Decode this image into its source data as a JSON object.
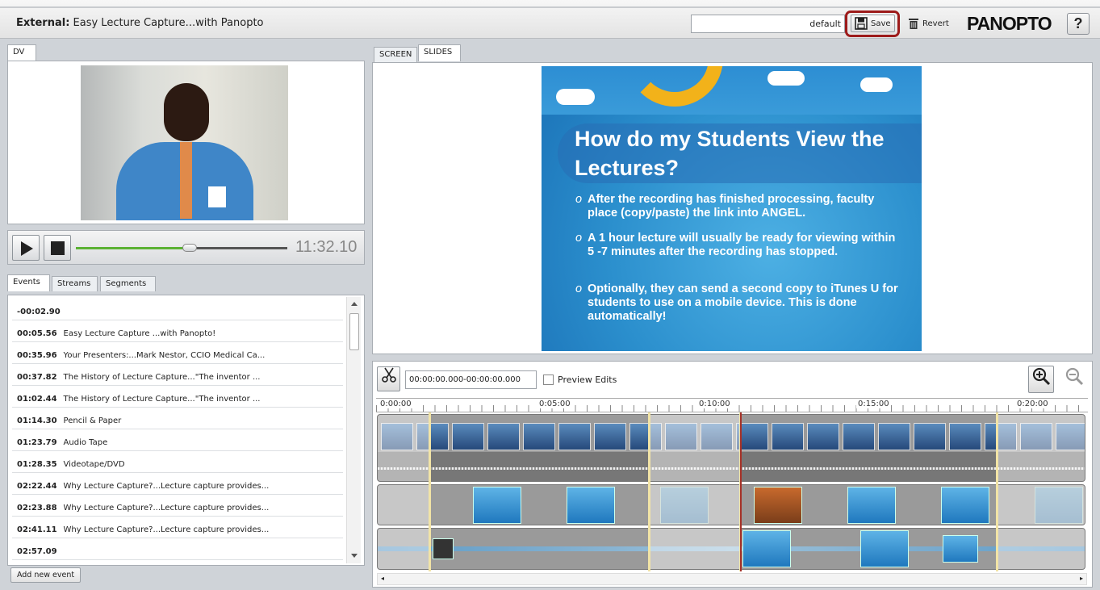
{
  "header": {
    "title_prefix": "External:",
    "title": "Easy Lecture Capture...with Panopto",
    "layout_value": "default",
    "save_label": "Save",
    "revert_label": "Revert",
    "logo_text": "PANOPTO",
    "help_label": "?"
  },
  "left": {
    "video_tab": "DV",
    "time": "11:32.10",
    "playback_progress": 0.54,
    "tabs": [
      "Events",
      "Streams",
      "Segments"
    ],
    "events": [
      {
        "time": "-00:02.90",
        "label": ""
      },
      {
        "time": "00:05.56",
        "label": "Easy Lecture Capture ...with Panopto!"
      },
      {
        "time": "00:35.96",
        "label": "Your Presenters:...Mark Nestor, CCIO Medical Ca..."
      },
      {
        "time": "00:37.82",
        "label": "The History of Lecture Capture...\"The inventor ..."
      },
      {
        "time": "01:02.44",
        "label": "The History of Lecture Capture...\"The inventor ..."
      },
      {
        "time": "01:14.30",
        "label": "Pencil & Paper"
      },
      {
        "time": "01:23.79",
        "label": "Audio Tape"
      },
      {
        "time": "01:28.35",
        "label": "Videotape/DVD"
      },
      {
        "time": "02:22.44",
        "label": "Why Lecture Capture?...Lecture capture provides..."
      },
      {
        "time": "02:23.88",
        "label": "Why Lecture Capture?...Lecture capture provides..."
      },
      {
        "time": "02:41.11",
        "label": "Why Lecture Capture?...Lecture capture provides..."
      },
      {
        "time": "02:57.09",
        "label": ""
      }
    ],
    "add_event_label": "Add new event"
  },
  "right": {
    "tabs": [
      "SCREEN",
      "SLIDES"
    ],
    "slide": {
      "title": "How do my Students View the Lectures?",
      "bullets": [
        "After the recording has finished processing, faculty place (copy/paste) the link into ANGEL.",
        "A 1 hour lecture will usually be ready for viewing within 5 -7 minutes after the recording has stopped.",
        "Optionally, they can send a second copy to iTunes U for students to use on a mobile device. This is done automatically!"
      ]
    }
  },
  "editor": {
    "range_value": "00:00:00.000-00:00:00.000",
    "preview_label": "Preview Edits",
    "ruler_labels": [
      "0:00:00",
      "0:05:00",
      "0:10:00",
      "0:15:00",
      "0:20:00"
    ]
  },
  "colors": {
    "accent_red": "#9d1b1b",
    "waveform_green": "#5bb133"
  }
}
